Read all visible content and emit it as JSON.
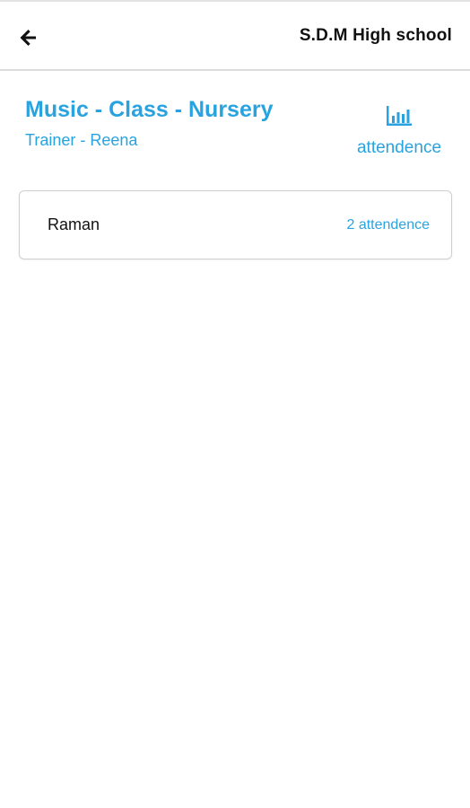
{
  "header": {
    "school_name": "S.D.M High school",
    "back_icon": "arrow-left-icon"
  },
  "class": {
    "title": "Music - Class - Nursery",
    "trainer": "Trainer - Reena"
  },
  "attendance_link": {
    "icon": "bar-chart-icon",
    "label": "attendence"
  },
  "students": [
    {
      "name": "Raman",
      "attendance": "2 attendence"
    }
  ],
  "colors": {
    "accent": "#29a3e0",
    "text": "#111111",
    "divider": "#dcdcdc",
    "card_border": "#cfcfcf"
  }
}
